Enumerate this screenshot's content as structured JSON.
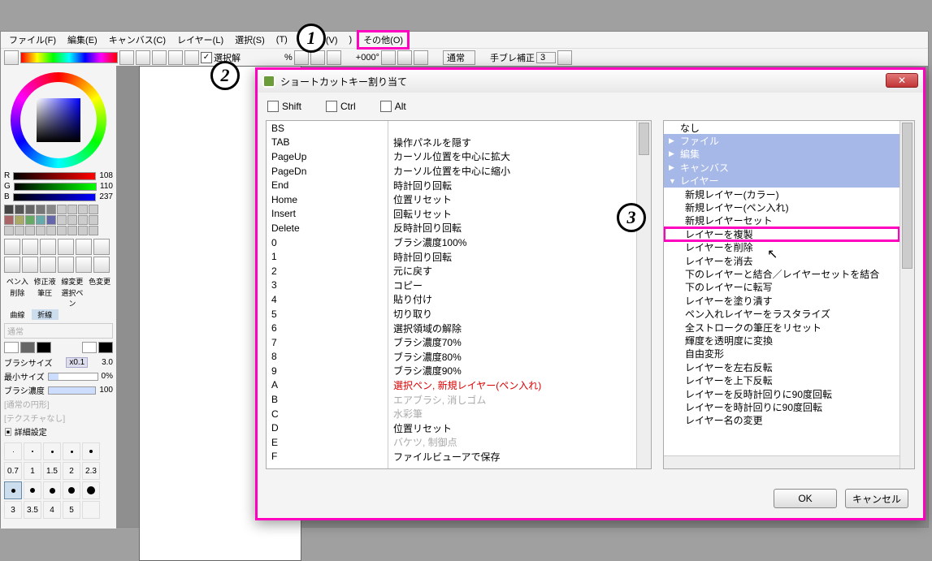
{
  "menubar": {
    "file": "ファイル(F)",
    "edit": "編集(E)",
    "canvas": "キャンバス(C)",
    "layer": "レイヤー(L)",
    "select": "選択(S)",
    "hidden1": "(T)",
    "view": "ビュー(V)",
    "hidden2": ")",
    "other": "その他(O)"
  },
  "toolbar": {
    "select_label": "選択解",
    "pct": "%",
    "angle": "+000°",
    "blendmode": "通常",
    "stabilizer_label": "手ブレ補正",
    "stabilizer_value": "3"
  },
  "rgb": {
    "r_label": "R",
    "r_val": "108",
    "g_label": "G",
    "g_val": "110",
    "b_label": "B",
    "b_val": "237"
  },
  "brush_params": {
    "size_label": "ブラシサイズ",
    "size_mult": "x0.1",
    "size_val": "3.0",
    "min_label": "最小サイズ",
    "min_val": "0%",
    "density_label": "ブラシ濃度",
    "density_val": "100",
    "detail": "詳細設定"
  },
  "brushnums": {
    "a": "0.7",
    "b": "1",
    "c": "1.5",
    "d": "2",
    "e": "2.3",
    "f": "3",
    "g": "3.5",
    "h": "4",
    "i": "5"
  },
  "dialog": {
    "title": "ショートカットキー割り当て",
    "shift": "Shift",
    "ctrl": "Ctrl",
    "alt": "Alt",
    "ok": "OK",
    "cancel": "キャンセル"
  },
  "keys": [
    {
      "k": "BS",
      "a": ""
    },
    {
      "k": "TAB",
      "a": "操作パネルを隠す"
    },
    {
      "k": "PageUp",
      "a": "カーソル位置を中心に拡大"
    },
    {
      "k": "PageDn",
      "a": "カーソル位置を中心に縮小"
    },
    {
      "k": "End",
      "a": "時計回り回転"
    },
    {
      "k": "Home",
      "a": "位置リセット"
    },
    {
      "k": "Insert",
      "a": "回転リセット"
    },
    {
      "k": "Delete",
      "a": "反時計回り回転"
    },
    {
      "k": "0",
      "a": "ブラシ濃度100%"
    },
    {
      "k": "1",
      "a": "時計回り回転"
    },
    {
      "k": "2",
      "a": "元に戻す"
    },
    {
      "k": "3",
      "a": "コピー"
    },
    {
      "k": "4",
      "a": "貼り付け"
    },
    {
      "k": "5",
      "a": "切り取り"
    },
    {
      "k": "6",
      "a": "選択領域の解除"
    },
    {
      "k": "7",
      "a": "ブラシ濃度70%"
    },
    {
      "k": "8",
      "a": "ブラシ濃度80%"
    },
    {
      "k": "9",
      "a": "ブラシ濃度90%"
    },
    {
      "k": "A",
      "a": "選択ペン, 新規レイヤー(ペン入れ)",
      "cls": "red"
    },
    {
      "k": "B",
      "a": "エアブラシ, 消しゴム",
      "cls": "gray"
    },
    {
      "k": "C",
      "a": "水彩筆",
      "cls": "gray"
    },
    {
      "k": "D",
      "a": "位置リセット"
    },
    {
      "k": "E",
      "a": "バケツ, 制御点",
      "cls": "gray"
    },
    {
      "k": "F",
      "a": "ファイルビューアで保存"
    }
  ],
  "cmds": {
    "none": "なし",
    "file": "ファイル",
    "edit": "編集",
    "canvas": "キャンバス",
    "layer": "レイヤー",
    "items": [
      "新規レイヤー(カラー)",
      "新規レイヤー(ペン入れ)",
      "新規レイヤーセット",
      "レイヤーを複製",
      "レイヤーを削除",
      "レイヤーを消去",
      "下のレイヤーと結合／レイヤーセットを結合",
      "下のレイヤーに転写",
      "レイヤーを塗り潰す",
      "ペン入れレイヤーをラスタライズ",
      "全ストロークの筆圧をリセット",
      "輝度を透明度に変換",
      "自由変形",
      "レイヤーを左右反転",
      "レイヤーを上下反転",
      "レイヤーを反時計回りに90度回転",
      "レイヤーを時計回りに90度回転",
      "レイヤー名の変更"
    ]
  },
  "callouts": {
    "c1": "1",
    "c2": "2",
    "c3": "3"
  },
  "tool_labels": {
    "pen": "ペン入",
    "mod": "修正液",
    "line": "線変更",
    "col": "色変更",
    "eraser": "削除",
    "brush": "筆圧",
    "selpen": "選択ペン",
    "curve": "曲線",
    "polyline": "折線",
    "normal": "通常"
  }
}
